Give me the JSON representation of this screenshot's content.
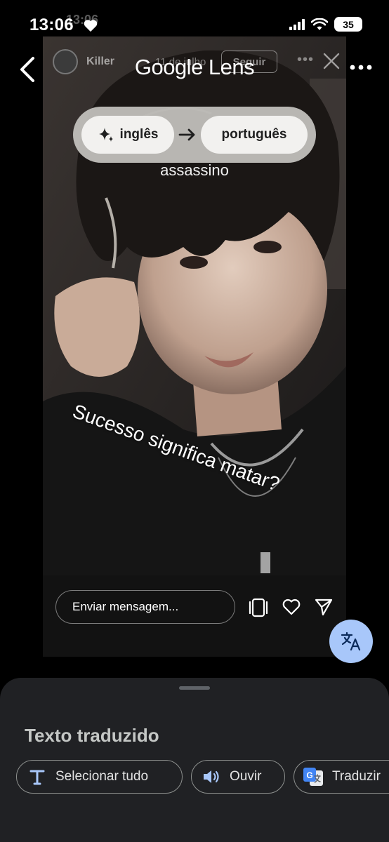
{
  "status_bar": {
    "time": "13:06",
    "ghost_time": "13:06",
    "battery": "35"
  },
  "story": {
    "username": "Killer",
    "date": "11 de julho",
    "follow_label": "Seguir",
    "more_label": "•••",
    "message_placeholder": "Enviar mensagem..."
  },
  "lens": {
    "title": "Google Lens",
    "source_language": "inglês",
    "target_language": "português",
    "translations": [
      "assassino",
      "Sucesso significa matar?"
    ]
  },
  "sheet": {
    "title": "Texto traduzido",
    "chips": {
      "select_all": "Selecionar tudo",
      "listen": "Ouvir",
      "translate": "Traduzir"
    }
  },
  "colors": {
    "fab_background": "#a8c7fa",
    "sheet_background": "#202124",
    "pill_background": "#c6c4c0"
  },
  "icons": [
    "back-arrow-icon",
    "more-vert-icon",
    "sparkle-icon",
    "arrow-right-icon",
    "translate-icon",
    "text-select-icon",
    "speaker-icon",
    "google-translate-icon",
    "heart-icon",
    "send-icon",
    "close-icon",
    "signal-icon",
    "wifi-icon"
  ]
}
